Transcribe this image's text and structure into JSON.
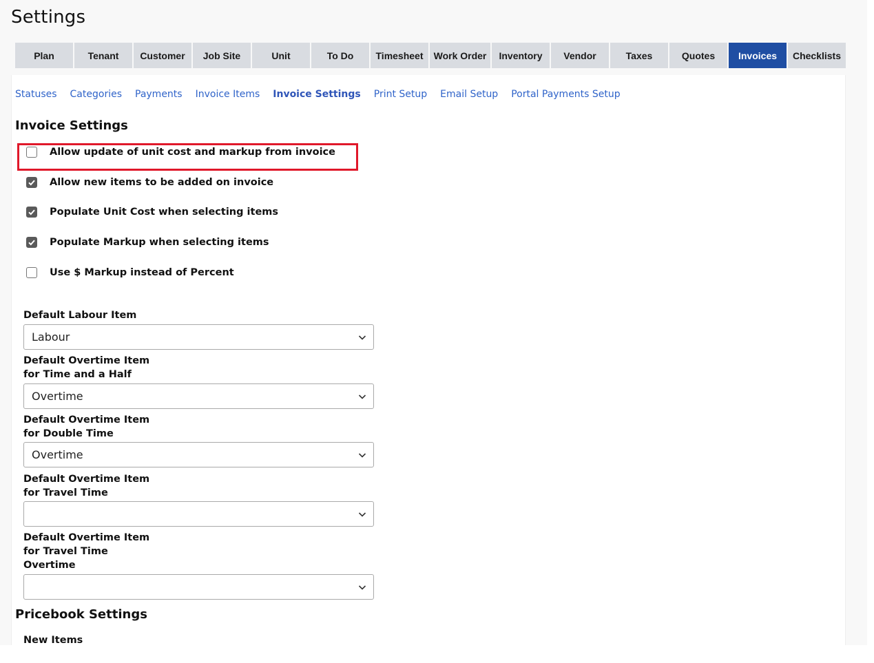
{
  "page": {
    "title": "Settings"
  },
  "tabs": [
    {
      "label": "Plan"
    },
    {
      "label": "Tenant"
    },
    {
      "label": "Customer"
    },
    {
      "label": "Job Site"
    },
    {
      "label": "Unit"
    },
    {
      "label": "To Do"
    },
    {
      "label": "Timesheet"
    },
    {
      "label": "Work Order"
    },
    {
      "label": "Inventory"
    },
    {
      "label": "Vendor"
    },
    {
      "label": "Taxes"
    },
    {
      "label": "Quotes"
    },
    {
      "label": "Invoices",
      "active": true
    },
    {
      "label": "Checklists"
    }
  ],
  "subnav": [
    {
      "label": "Statuses"
    },
    {
      "label": "Categories"
    },
    {
      "label": "Payments"
    },
    {
      "label": "Invoice Items"
    },
    {
      "label": "Invoice Settings",
      "active": true
    },
    {
      "label": "Print Setup"
    },
    {
      "label": "Email Setup"
    },
    {
      "label": "Portal Payments Setup"
    }
  ],
  "invoice_settings": {
    "title": "Invoice Settings",
    "checkboxes": [
      {
        "label": "Allow update of unit cost and markup from invoice",
        "checked": false
      },
      {
        "label": "Allow new items to be added on invoice",
        "checked": true
      },
      {
        "label": "Populate Unit Cost when selecting items",
        "checked": true
      },
      {
        "label": "Populate Markup when selecting items",
        "checked": true
      },
      {
        "label": "Use $ Markup instead of Percent",
        "checked": false
      }
    ],
    "selects": [
      {
        "label_lines": [
          "Default Labour Item"
        ],
        "value": "Labour"
      },
      {
        "label_lines": [
          "Default Overtime Item",
          "for Time and a Half"
        ],
        "value": "Overtime"
      },
      {
        "label_lines": [
          "Default Overtime Item",
          "for Double Time"
        ],
        "value": "Overtime"
      },
      {
        "label_lines": [
          "Default Overtime Item",
          "for Travel Time"
        ],
        "value": ""
      },
      {
        "label_lines": [
          "Default Overtime Item",
          "for Travel Time",
          "Overtime"
        ],
        "value": ""
      }
    ]
  },
  "pricebook_settings": {
    "title": "Pricebook Settings",
    "new_items_label": "New Items"
  },
  "colors": {
    "active_tab": "#1f4ea3",
    "link": "#2f63c9",
    "highlight": "#e0182a"
  },
  "icons": {
    "select_arrow": "chevron-down-icon",
    "check": "checkmark-icon"
  }
}
